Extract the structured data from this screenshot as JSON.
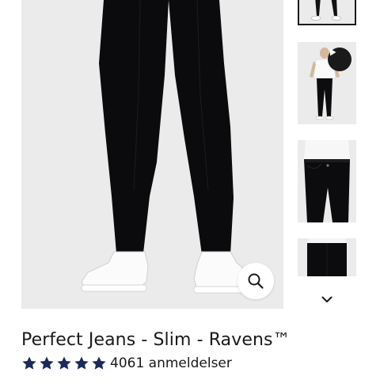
{
  "product": {
    "title": "Perfect Jeans - Slim - Ravens™",
    "rating": {
      "stars": 5,
      "review_count": "4061",
      "review_label": "anmeldelser",
      "star_color": "#1b2a57"
    }
  },
  "gallery": {
    "selected_index": 0,
    "thumbnails": [
      {
        "kind": "image",
        "subject": "jeans-full-body"
      },
      {
        "kind": "video",
        "subject": "model-white-tee-black-jeans",
        "icon": "play-icon"
      },
      {
        "kind": "image",
        "subject": "jeans-waist-detail"
      },
      {
        "kind": "image",
        "subject": "jeans-back-detail"
      }
    ],
    "controls": {
      "zoom_icon": "magnifier-icon",
      "next_icon": "chevron-down-icon"
    }
  },
  "colors": {
    "background": "#ffffff",
    "image_background": "#ebebeb",
    "text": "#1a1a1a",
    "accent": "#1b2a57"
  }
}
